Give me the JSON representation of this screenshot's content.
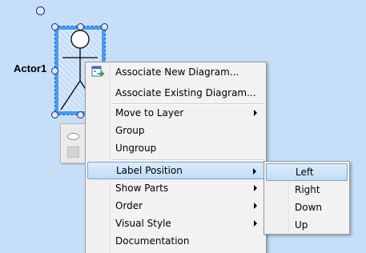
{
  "diagram": {
    "actor_name": "Actor1"
  },
  "context_menu": {
    "items": [
      {
        "label": "Associate New Diagram...",
        "icon": "new-diagram-plus-icon",
        "has_submenu": false
      },
      {
        "label": "Associate Existing Diagram...",
        "has_submenu": false
      },
      {
        "label": "Move to Layer",
        "has_submenu": true
      },
      {
        "label": "Group",
        "has_submenu": false
      },
      {
        "label": "Ungroup",
        "has_submenu": false
      },
      {
        "label": "Label Position",
        "has_submenu": true,
        "highlighted": true
      },
      {
        "label": "Show Parts",
        "has_submenu": true
      },
      {
        "label": "Order",
        "has_submenu": true
      },
      {
        "label": "Visual Style",
        "has_submenu": true
      },
      {
        "label": "Documentation",
        "has_submenu": false
      }
    ]
  },
  "label_position_submenu": {
    "items": [
      {
        "label": "Left",
        "highlighted": true
      },
      {
        "label": "Right"
      },
      {
        "label": "Down"
      },
      {
        "label": "Up"
      }
    ]
  },
  "colors": {
    "canvas_background": "#c6def8",
    "selection_border": "#4a9bea",
    "menu_highlight": "#c2dcf7",
    "icon_green": "#2da43a"
  }
}
